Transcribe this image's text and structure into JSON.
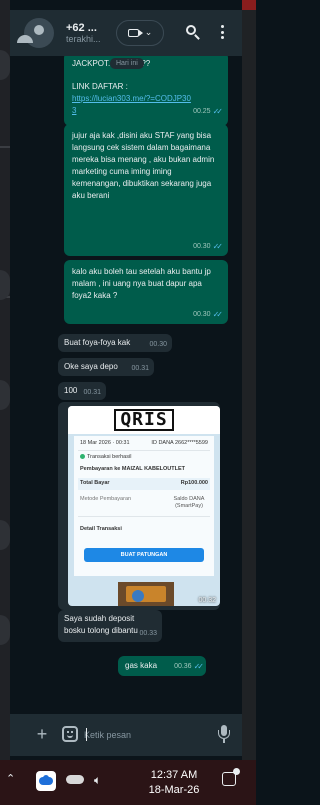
{
  "header": {
    "contact_name": "+62 ...",
    "contact_status": "terakhi..."
  },
  "date_chip": "Hari ini",
  "messages": [
    {
      "direction": "out",
      "text_top": "JACKPOT... ...MAU??",
      "text_link_label": "LINK DAFTAR :",
      "link": "https://lucian303.me/?=CODJP303",
      "time": "00.25"
    },
    {
      "direction": "out",
      "text": "jujur aja kak ,disini aku STAF yang bisa langsung cek sistem dalam bagaimana mereka bisa menang , aku bukan admin marketing cuma iming iming kemenangan, dibuktikan sekarang juga aku berani",
      "time": "00.30"
    },
    {
      "direction": "out",
      "text": "kalo aku boleh tau setelah aku bantu jp malam , ini uang nya buat dapur apa foya2 kaka ?",
      "time": "00.30"
    },
    {
      "direction": "in",
      "text": "Buat foya-foya kak",
      "time": "00.30"
    },
    {
      "direction": "in",
      "text": "Oke saya depo",
      "time": "00.31"
    },
    {
      "direction": "in",
      "text": "100",
      "time": "00.31"
    },
    {
      "direction": "in",
      "text": "Saya sudah deposit bosku tolong dibantu",
      "time": "00.33"
    },
    {
      "direction": "out",
      "text": "gas kaka",
      "time": "00.36"
    }
  ],
  "receipt": {
    "logo": "QRIS",
    "date_line": "18 Mar 2026 · 00:31",
    "id_line": "ID DANA 2662****5599",
    "status": "Transaksi berhasil",
    "merchant": "Pembayaran ke MAIZAL KABELOUTLET",
    "total_label": "Total Bayar",
    "total_value": "Rp100.000",
    "method_label": "Metode Pembayaran",
    "method_value": "Saldo DANA (SmartPay)",
    "details_label": "Detail Transaksi",
    "button_label": "BUAT PATUNGAN",
    "time": "00.32"
  },
  "composer": {
    "placeholder": "Ketik pesan"
  },
  "taskbar": {
    "time": "12:37 AM",
    "date": "18-Mar-26"
  },
  "icons": {
    "header": [
      "avatar",
      "video-call-icon",
      "search-icon",
      "menu-icon"
    ],
    "composer": [
      "plus-icon",
      "sticker-icon",
      "mic-icon"
    ],
    "taskbar": [
      "caret-up-icon",
      "app-icon",
      "onedrive-icon",
      "speaker-icon",
      "notification-icon"
    ]
  },
  "colors": {
    "outgoing_bubble": "#005c4b",
    "incoming_bubble": "#202c33",
    "background": "#0b141a",
    "header": "#1f2c33",
    "tick_read": "#53bdeb"
  }
}
